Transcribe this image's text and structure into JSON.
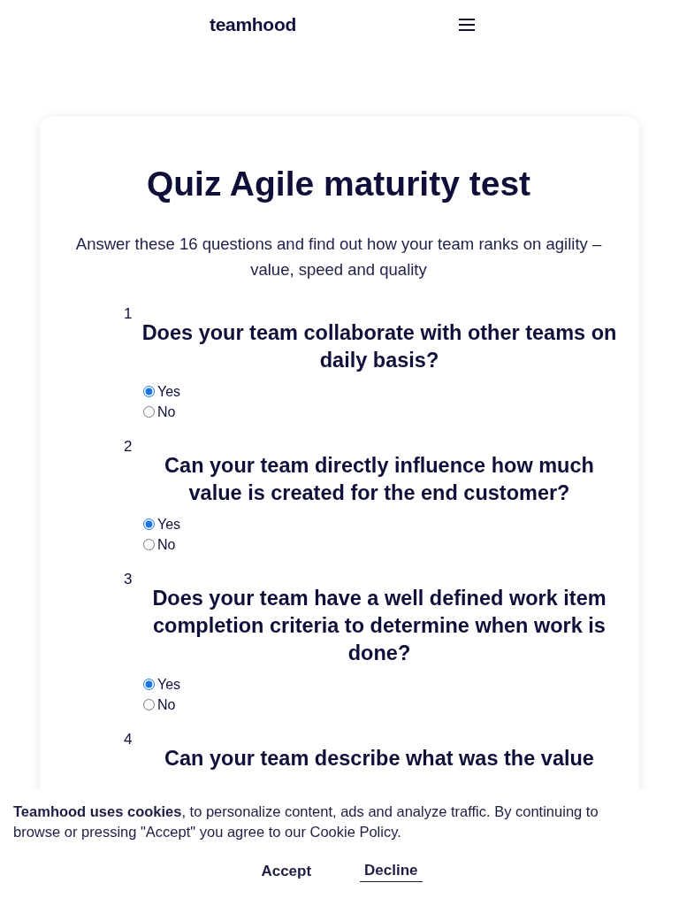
{
  "header": {
    "logo": "teamhood"
  },
  "quiz": {
    "title": "Quiz Agile maturity test",
    "intro": "Answer these 16 questions and find out how your team ranks on agility – value, speed and quality",
    "questions": [
      {
        "number": "1",
        "text": "Does your team collaborate with other teams on daily basis?",
        "options": [
          {
            "label": "Yes",
            "selected": true
          },
          {
            "label": "No",
            "selected": false
          }
        ]
      },
      {
        "number": "2",
        "text": "Can your team directly influence how much value is created for the end customer?",
        "options": [
          {
            "label": "Yes",
            "selected": true
          },
          {
            "label": "No",
            "selected": false
          }
        ]
      },
      {
        "number": "3",
        "text": "Does your team have a well defined work item completion criteria to determine when work is done?",
        "options": [
          {
            "label": "Yes",
            "selected": true
          },
          {
            "label": "No",
            "selected": false
          }
        ]
      },
      {
        "number": "4",
        "text": "Can your team describe what was the value"
      }
    ]
  },
  "cookie_banner": {
    "text": "**Teamhood uses cookies**, to personalize content, ads and analyze traffic. By continuing to browse or pressing \"Accept\" you agree to our Cookie Policy.",
    "buttons": [
      {
        "label": "Accept",
        "kind": "plain"
      },
      {
        "label": "Decline",
        "kind": "underlined"
      }
    ]
  }
}
